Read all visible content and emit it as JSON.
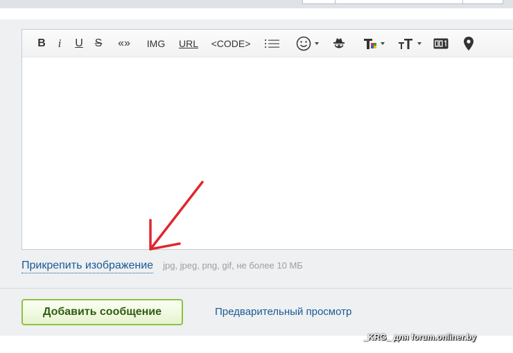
{
  "toolbar": {
    "bold": "B",
    "italic": "i",
    "underline": "U",
    "strike": "S",
    "quote": "«»",
    "img": "IMG",
    "url": "URL",
    "code": "<CODE>"
  },
  "attach": {
    "link_label": "Прикрепить изображение",
    "hint": "jpg, jpeg, png, gif, не более 10 МБ"
  },
  "actions": {
    "submit_label": "Добавить сообщение",
    "preview_label": "Предварительный просмотр"
  },
  "watermark": "_KRG_ для forum.onliner.by",
  "colors": {
    "annotation_arrow": "#e0262d",
    "submit_border": "#8cc23e",
    "link": "#1a5a94"
  }
}
